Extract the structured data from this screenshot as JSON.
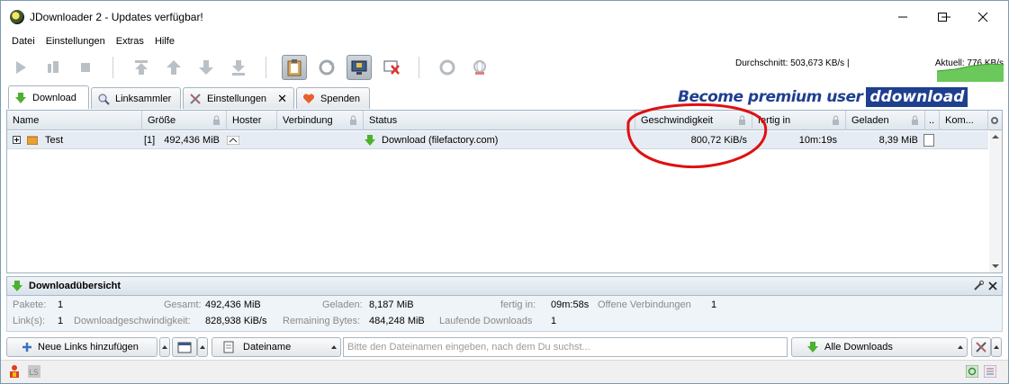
{
  "window": {
    "title": "JDownloader 2 - Updates verfügbar!"
  },
  "menu": [
    "Datei",
    "Einstellungen",
    "Extras",
    "Hilfe"
  ],
  "toolbar": {
    "speed_average": "Durchschnitt: 503,673 KB/s |",
    "speed_current": "Aktuell: 776 KB/s"
  },
  "tabs": [
    {
      "label": "Download",
      "icon": "download-arrow-icon",
      "active": true
    },
    {
      "label": "Linksammler",
      "icon": "magnifier-icon",
      "active": false
    },
    {
      "label": "Einstellungen",
      "icon": "tools-icon",
      "active": false,
      "closable": true
    },
    {
      "label": "Spenden",
      "icon": "heart-icon",
      "active": false
    }
  ],
  "banner": {
    "text": "Become premium user",
    "logo": "ddownload"
  },
  "table": {
    "columns": [
      "Name",
      "Größe",
      "Hoster",
      "Verbindung",
      "Status",
      "Geschwindigkeit",
      "fertig in",
      "Geladen",
      "..",
      "Kom..."
    ],
    "rows": [
      {
        "name": "Test",
        "count": "[1]",
        "size": "492,436 MiB",
        "status": "Download (filefactory.com)",
        "speed": "800,72 KiB/s",
        "eta": "10m:19s",
        "loaded": "8,39 MiB"
      }
    ]
  },
  "overview": {
    "title": "Downloadübersicht",
    "pakete_label": "Pakete:",
    "pakete": "1",
    "gesamt_label": "Gesamt:",
    "gesamt": "492,436 MiB",
    "geladen_label": "Geladen:",
    "geladen": "8,187 MiB",
    "fertig_label": "fertig in:",
    "fertig": "09m:58s",
    "offene_label": "Offene Verbindungen",
    "offene": "1",
    "links_label": "Link(s):",
    "links": "1",
    "dlspeed_label": "Downloadgeschwindigkeit:",
    "dlspeed": "828,938 KiB/s",
    "remaining_label": "Remaining Bytes:",
    "remaining": "484,248 MiB",
    "laufende_label": "Laufende Downloads",
    "laufende": "1"
  },
  "bottom": {
    "add_links": "Neue Links hinzufügen",
    "sort_field": "Dateiname",
    "search_placeholder": "Bitte den Dateinamen eingeben, nach dem Du suchst...",
    "filter": "Alle Downloads"
  },
  "colors": {
    "accent_blue": "#1f3f8f",
    "annotation_red": "#e01010",
    "row_highlight": "#e6ecf3"
  }
}
